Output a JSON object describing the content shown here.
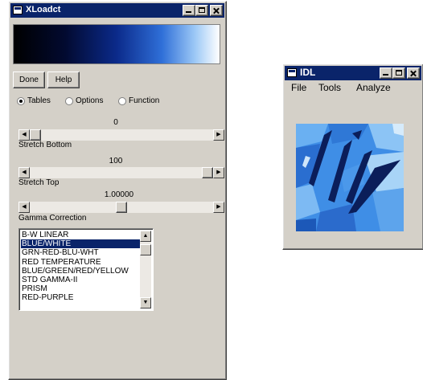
{
  "xloadct": {
    "title": "XLoadct",
    "buttons": {
      "done": "Done",
      "help": "Help"
    },
    "radios": [
      {
        "label": "Tables",
        "selected": true
      },
      {
        "label": "Options",
        "selected": false
      },
      {
        "label": "Function",
        "selected": false
      }
    ],
    "stretch_bottom": {
      "value": "0",
      "label": "Stretch Bottom",
      "level": 0.0
    },
    "stretch_top": {
      "value": "100",
      "label": "Stretch Top",
      "level": 1.0
    },
    "gamma": {
      "value": "1.00000",
      "label": "Gamma Correction",
      "level": 0.5
    },
    "color_tables": [
      "B-W LINEAR",
      "BLUE/WHITE",
      "GRN-RED-BLU-WHT",
      "RED TEMPERATURE",
      "BLUE/GREEN/RED/YELLOW",
      "STD GAMMA-II",
      "PRISM",
      "RED-PURPLE"
    ],
    "selected_table_index": 1
  },
  "idl_window": {
    "title": "IDL",
    "menu": [
      "File",
      "Tools",
      "Analyze"
    ]
  },
  "colors": {
    "titlebar": "#0a246a",
    "window_face": "#d4d0c8",
    "selection": "#0a246a"
  }
}
